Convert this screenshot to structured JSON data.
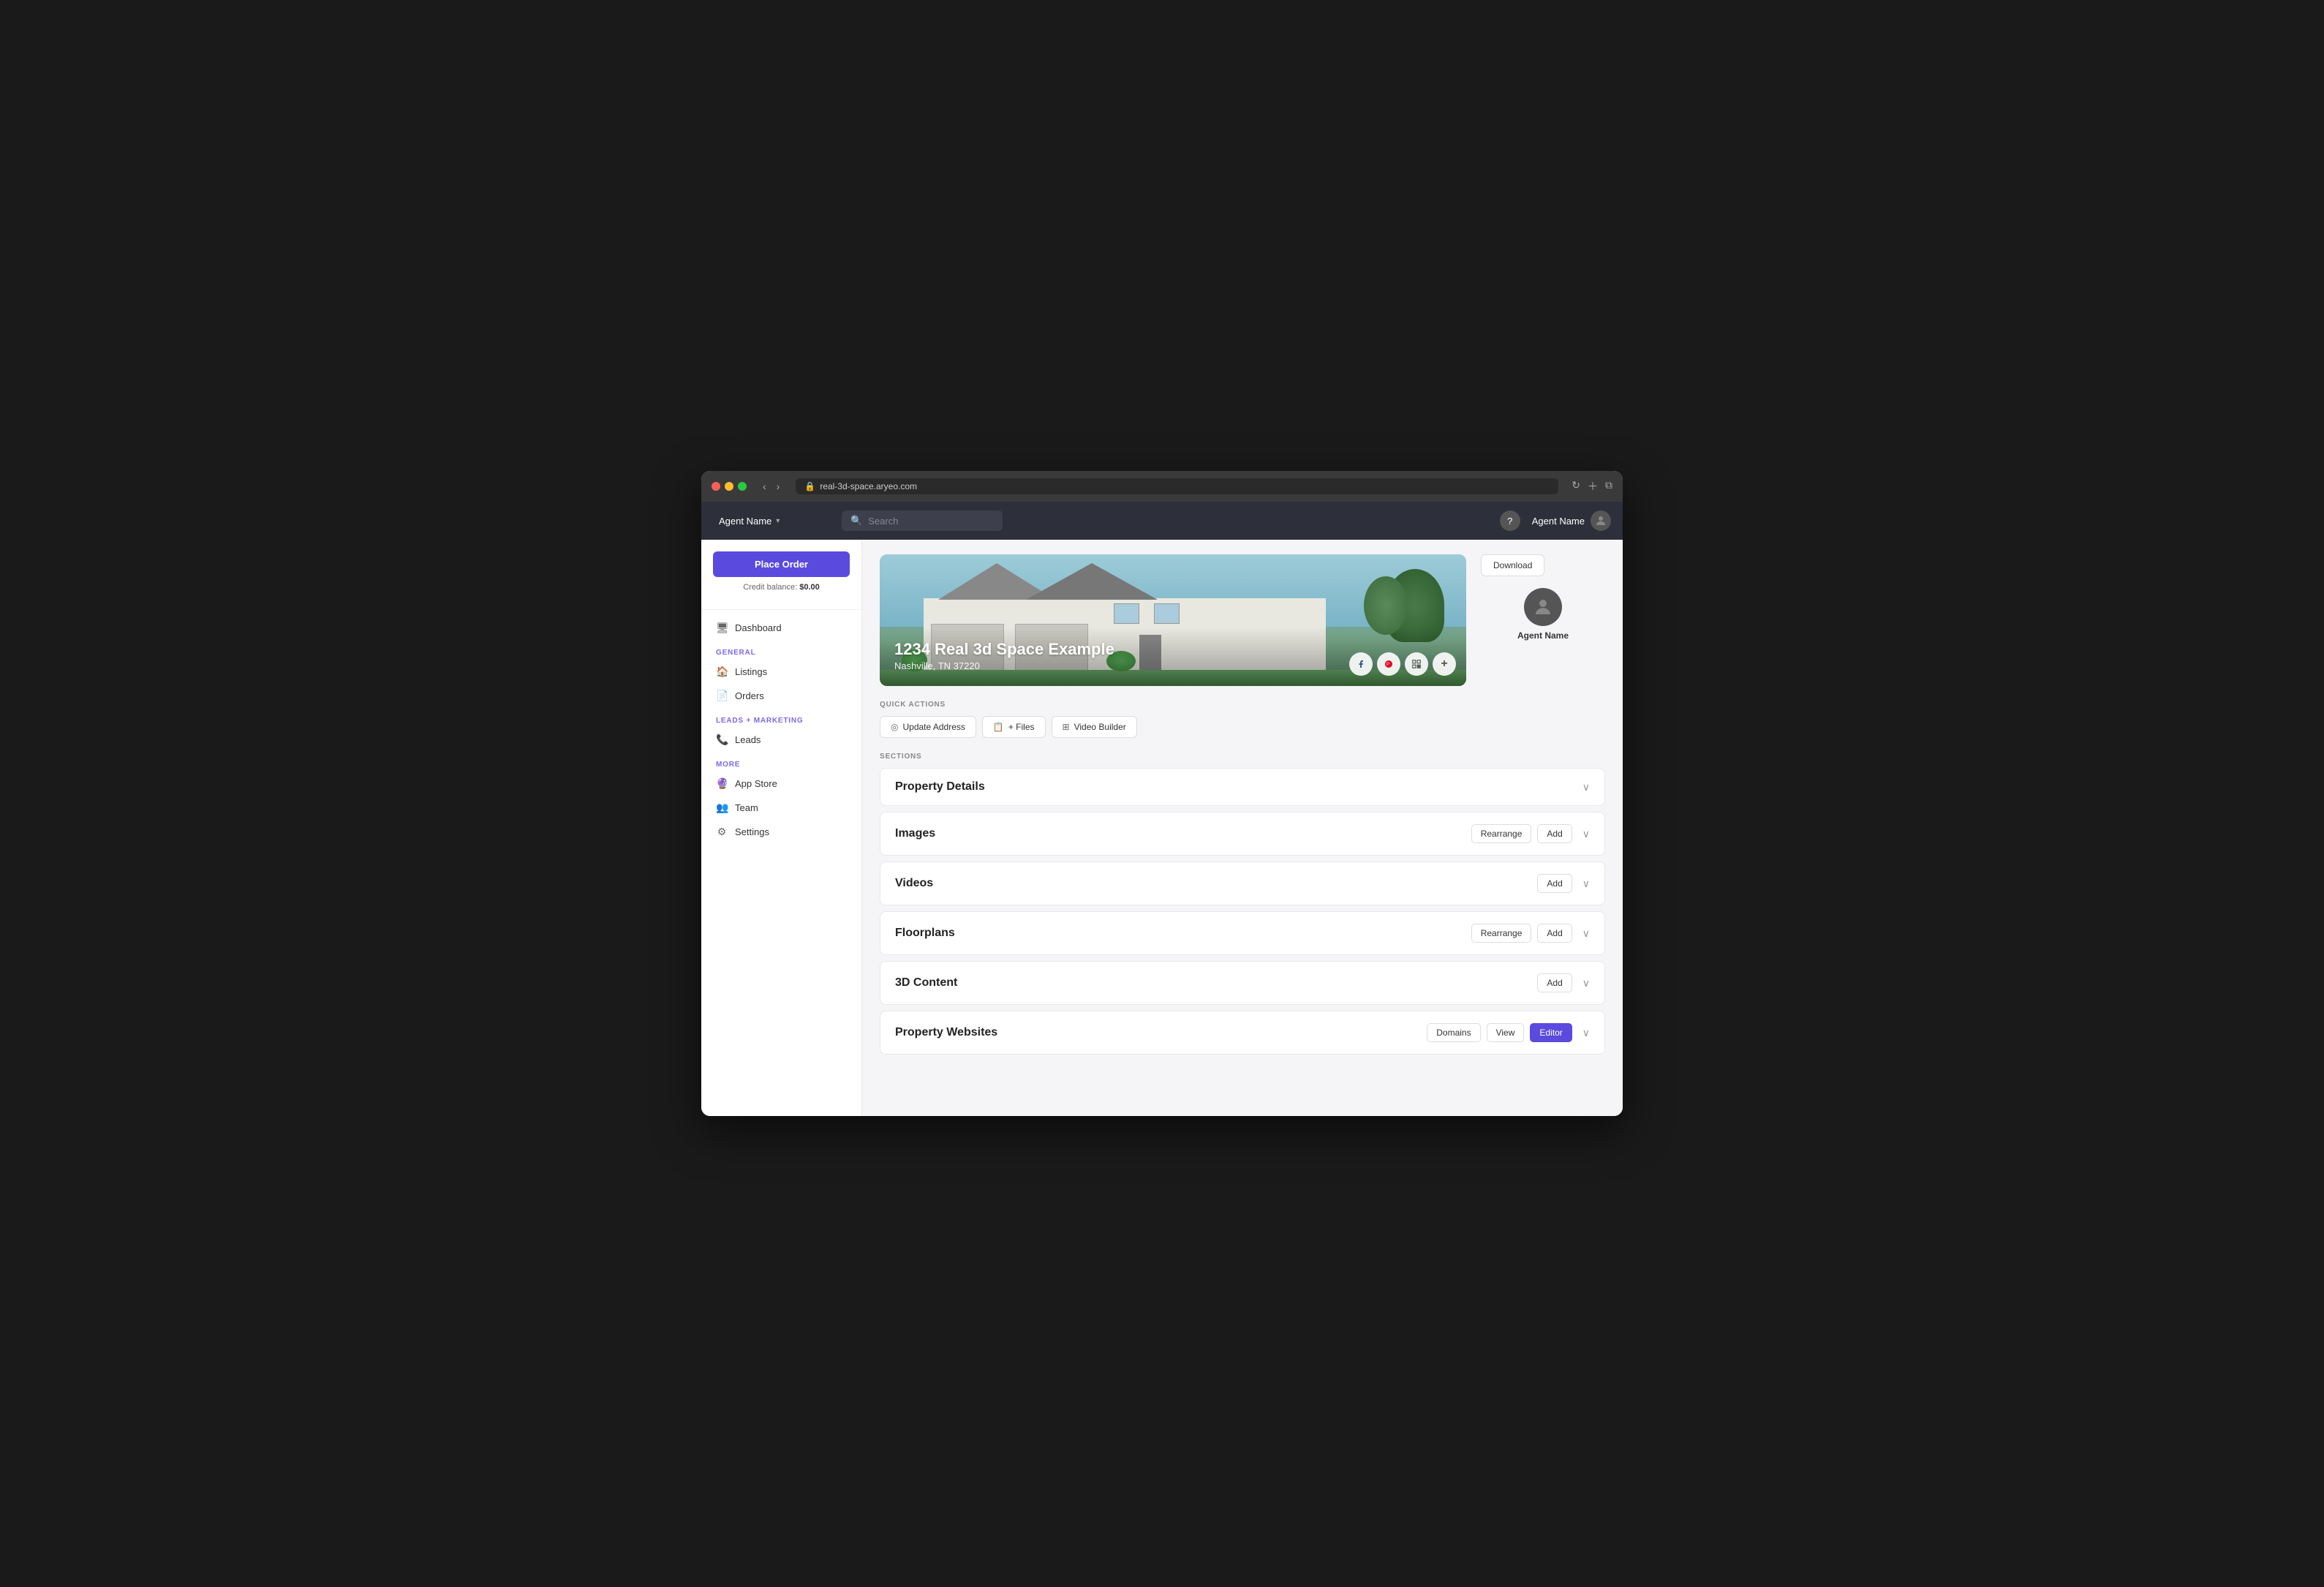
{
  "browser": {
    "url": "real-3d-space.aryeo.com"
  },
  "nav": {
    "agent_name": "Agent Name",
    "search_placeholder": "Search",
    "help_label": "?",
    "dropdown_icon": "▾"
  },
  "sidebar": {
    "place_order_label": "Place Order",
    "credit_balance_label": "Credit balance:",
    "credit_balance_value": "$0.00",
    "general_label": "GENERAL",
    "more_label": "MORE",
    "leads_marketing_label": "LEADS + MARKETING",
    "items": [
      {
        "id": "dashboard",
        "label": "Dashboard",
        "icon": "🖥"
      },
      {
        "id": "listings",
        "label": "Listings",
        "icon": "🏠"
      },
      {
        "id": "orders",
        "label": "Orders",
        "icon": "📄"
      },
      {
        "id": "leads",
        "label": "Leads",
        "icon": "📞"
      },
      {
        "id": "app-store",
        "label": "App Store",
        "icon": "🔮"
      },
      {
        "id": "team",
        "label": "Team",
        "icon": "👥"
      },
      {
        "id": "settings",
        "label": "Settings",
        "icon": "⚙"
      }
    ]
  },
  "listing": {
    "title": "1234 Real 3d Space Example",
    "address": "Nashville, TN 37220"
  },
  "agent_panel": {
    "download_label": "Download",
    "agent_name": "Agent Name"
  },
  "quick_actions": {
    "label": "QUICK ACTIONS",
    "buttons": [
      {
        "id": "update-address",
        "label": "Update Address",
        "icon": "◎"
      },
      {
        "id": "files",
        "label": "+ Files",
        "icon": "📋"
      },
      {
        "id": "video-builder",
        "label": "Video Builder",
        "icon": "⊞"
      }
    ]
  },
  "sections": {
    "label": "SECTIONS",
    "items": [
      {
        "id": "property-details",
        "title": "Property Details",
        "actions": []
      },
      {
        "id": "images",
        "title": "Images",
        "actions": [
          {
            "id": "rearrange",
            "label": "Rearrange",
            "primary": false
          },
          {
            "id": "add",
            "label": "Add",
            "primary": false
          }
        ]
      },
      {
        "id": "videos",
        "title": "Videos",
        "actions": [
          {
            "id": "add",
            "label": "Add",
            "primary": false
          }
        ]
      },
      {
        "id": "floorplans",
        "title": "Floorplans",
        "actions": [
          {
            "id": "rearrange",
            "label": "Rearrange",
            "primary": false
          },
          {
            "id": "add",
            "label": "Add",
            "primary": false
          }
        ]
      },
      {
        "id": "3d-content",
        "title": "3D Content",
        "actions": [
          {
            "id": "add",
            "label": "Add",
            "primary": false
          }
        ]
      },
      {
        "id": "property-websites",
        "title": "Property Websites",
        "actions": [
          {
            "id": "domains",
            "label": "Domains",
            "primary": false
          },
          {
            "id": "view",
            "label": "View",
            "primary": false
          },
          {
            "id": "editor",
            "label": "Editor",
            "primary": true
          }
        ]
      }
    ]
  }
}
